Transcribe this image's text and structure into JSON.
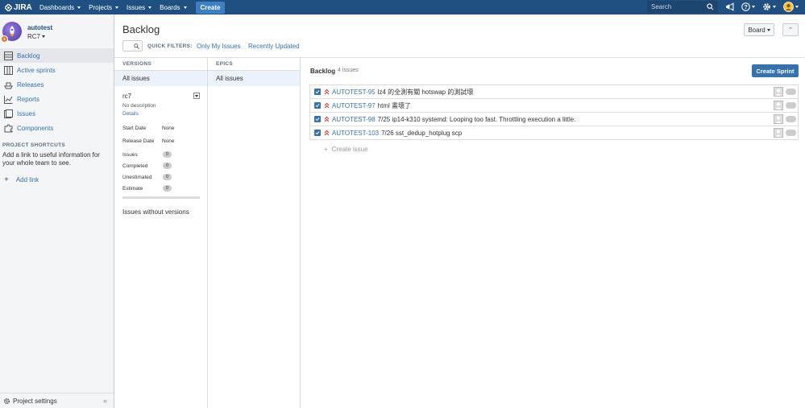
{
  "topnav": {
    "logo": "JIRA",
    "items": [
      {
        "label": "Dashboards"
      },
      {
        "label": "Projects"
      },
      {
        "label": "Issues"
      },
      {
        "label": "Boards"
      }
    ],
    "create_label": "Create",
    "search_placeholder": "Search",
    "icons": [
      "megaphone-icon",
      "help-icon",
      "gear-icon",
      "user-avatar-icon"
    ]
  },
  "sidebar": {
    "project_name": "autotest",
    "project_version": "RC7",
    "items": [
      {
        "label": "Backlog",
        "icon": "backlog-icon",
        "active": true
      },
      {
        "label": "Active sprints",
        "icon": "board-icon"
      },
      {
        "label": "Releases",
        "icon": "ship-icon"
      },
      {
        "label": "Reports",
        "icon": "chart-icon"
      },
      {
        "label": "Issues",
        "icon": "issues-icon"
      },
      {
        "label": "Components",
        "icon": "puzzle-icon"
      }
    ],
    "shortcuts_title": "PROJECT SHORTCUTS",
    "shortcuts_text": "Add a link to useful information for your whole team to see.",
    "add_link": "Add link",
    "settings": "Project settings"
  },
  "header": {
    "title": "Backlog",
    "quick_filters_label": "QUICK FILTERS:",
    "filters": [
      "Only My Issues",
      "Recently Updated"
    ],
    "board_button": "Board"
  },
  "versions": {
    "heading": "VERSIONS",
    "all_issues": "All issues",
    "version": {
      "name": "rc7",
      "description": "No description",
      "details": "Details",
      "start_date_label": "Start Date",
      "start_date": "None",
      "release_date_label": "Release Date",
      "release_date": "None",
      "issues_label": "Issues",
      "issues": "0",
      "completed_label": "Completed",
      "completed": "0",
      "unestimated_label": "Unestimated",
      "unestimated": "0",
      "estimate_label": "Estimate",
      "estimate": "0"
    },
    "without": "Issues without versions"
  },
  "epics": {
    "heading": "EPICS",
    "all_issues": "All issues"
  },
  "backlog": {
    "title": "Backlog",
    "count": "4 issues",
    "create_sprint": "Create Sprint",
    "issues": [
      {
        "key": "AUTOTEST-95",
        "summary": "lz4 的全測有關 hotswap 的測試壞"
      },
      {
        "key": "AUTOTEST-97",
        "summary": "html 畫壞了"
      },
      {
        "key": "AUTOTEST-98",
        "summary": "7/25 ip14-k310 systemd: Looping too fast. Throttling execution a little."
      },
      {
        "key": "AUTOTEST-103",
        "summary": "7/26 sst_dedup_hotplug scp"
      }
    ],
    "create_issue": "Create issue"
  },
  "colors": {
    "nav": "#205081",
    "link": "#3572b0",
    "priority": "#d04437"
  }
}
